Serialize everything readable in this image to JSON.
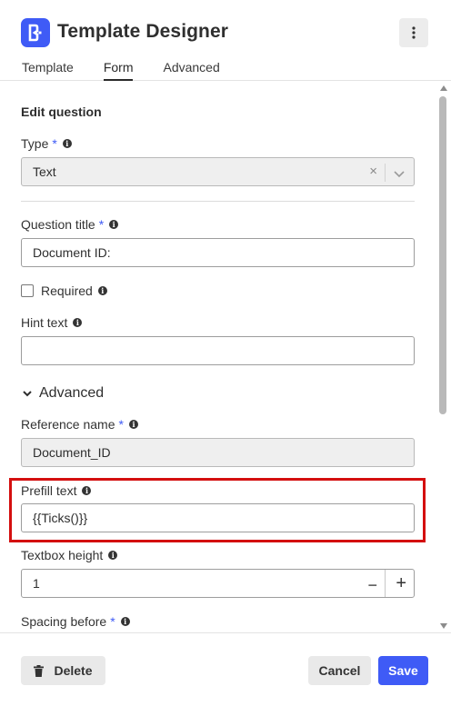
{
  "app": {
    "title": "Template Designer",
    "brand_color": "#3f5bf6"
  },
  "tabs": [
    {
      "label": "Template",
      "active": false
    },
    {
      "label": "Form",
      "active": true
    },
    {
      "label": "Advanced",
      "active": false
    }
  ],
  "form": {
    "section_title": "Edit question",
    "type": {
      "label": "Type",
      "required_mark": "*",
      "value": "Text",
      "clear_glyph": "×"
    },
    "question_title": {
      "label": "Question title",
      "required_mark": "*",
      "value": "Document ID:"
    },
    "required": {
      "label": "Required",
      "checked": false
    },
    "hint_text": {
      "label": "Hint text",
      "value": ""
    },
    "advanced_toggle": {
      "label": "Advanced",
      "expanded": true
    },
    "reference_name": {
      "label": "Reference name",
      "required_mark": "*",
      "value": "Document_ID"
    },
    "prefill_text": {
      "label": "Prefill text",
      "value": "{{Ticks()}}"
    },
    "textbox_height": {
      "label": "Textbox height",
      "value": "1",
      "minus": "−",
      "plus": "+"
    },
    "spacing_before": {
      "label": "Spacing before",
      "required_mark": "*"
    }
  },
  "footer": {
    "delete_label": "Delete",
    "cancel_label": "Cancel",
    "save_label": "Save"
  },
  "icons": {
    "logo": "brand-logo-icon",
    "more": "kebab-menu-icon",
    "info": "info-icon",
    "trash": "trash-icon",
    "chevron": "chevron-down-icon"
  },
  "colors": {
    "highlight": "#d40f0f",
    "primary": "#3f5bf6"
  }
}
